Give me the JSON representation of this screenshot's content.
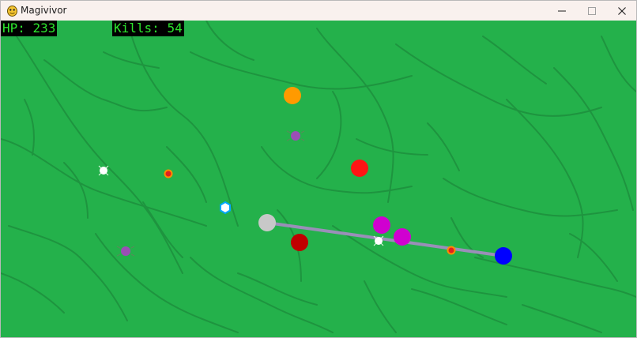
{
  "window": {
    "title": "Magivivor",
    "app_icon": "pygame-snake-icon"
  },
  "controls": {
    "minimize_icon": "minimize-icon",
    "maximize_icon": "maximize-icon",
    "close_icon": "close-icon"
  },
  "hud": {
    "hp_label": "HP: ",
    "hp_value": "233",
    "kills_label": "Kills: ",
    "kills_value": "54"
  },
  "colors": {
    "background": "#24b14b",
    "hud_text": "#2de62d",
    "hud_background": "#000000",
    "player": "#c8c8c8",
    "beam": "#9a8fb8",
    "orange_enemy": "#ff9a00",
    "red_enemy": "#ff1414",
    "dark_red_enemy": "#c00000",
    "magenta_enemy": "#d000d0",
    "blue_enemy": "#0000ff",
    "purple_bug": "#9b4fb5",
    "xp_gem": "#00a8ff"
  }
}
